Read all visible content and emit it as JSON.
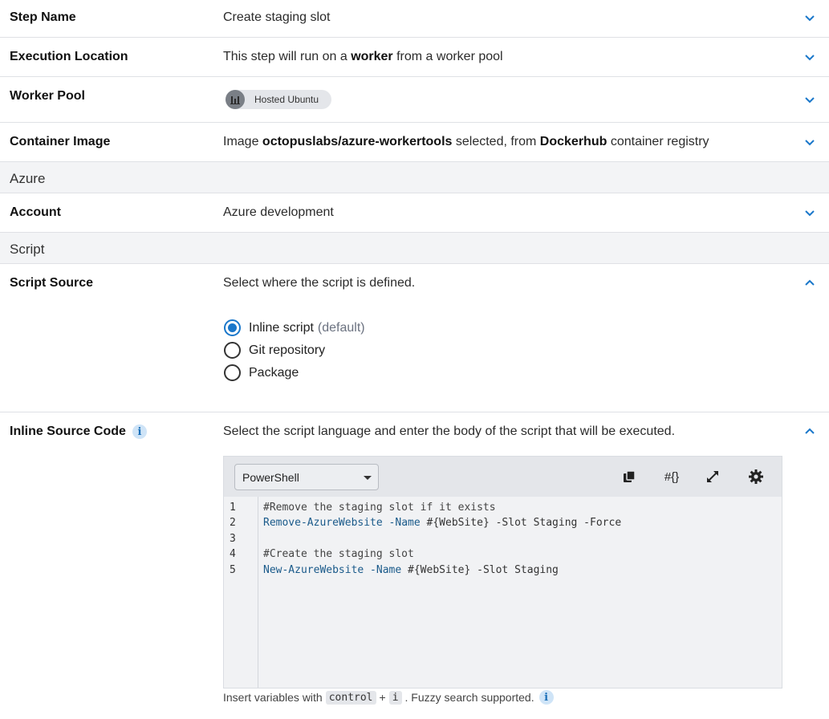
{
  "rows": {
    "step_name": {
      "label": "Step Name",
      "value": "Create staging slot"
    },
    "execution_location": {
      "label": "Execution Location",
      "value_pre": "This step will run on a ",
      "value_bold": "worker",
      "value_post": " from a worker pool"
    },
    "worker_pool": {
      "label": "Worker Pool",
      "chip_text": "Hosted Ubuntu",
      "chip_icon": "bar-chart-icon"
    },
    "container_image": {
      "label": "Container Image",
      "pre": "Image ",
      "image": "octopuslabs/azure-workertools",
      "mid": " selected, from ",
      "registry": "Dockerhub",
      "post": " container registry"
    },
    "account": {
      "label": "Account",
      "value": "Azure development"
    },
    "script_source": {
      "label": "Script Source",
      "value": "Select where the script is defined."
    },
    "inline_source": {
      "label": "Inline Source Code",
      "info": "i",
      "value": "Select the script language and enter the body of the script that will be executed."
    }
  },
  "sections": {
    "azure": "Azure",
    "script": "Script"
  },
  "script_source_options": [
    {
      "label": "Inline script",
      "suffix": "(default)",
      "selected": true
    },
    {
      "label": "Git repository",
      "selected": false
    },
    {
      "label": "Package",
      "selected": false
    }
  ],
  "editor": {
    "language": "PowerShell",
    "toolbar_icons": [
      "copy-icon",
      "variable-icon",
      "expand-icon",
      "settings-icon"
    ],
    "variable_glyph": "#{}",
    "line_numbers": [
      "1",
      "2",
      "3",
      "4",
      "5"
    ],
    "lines": [
      {
        "comment": "#Remove the staging slot if it exists"
      },
      {
        "cmd": "Remove-AzureWebsite",
        "param": " -Name",
        "rest": " #{WebSite} -Slot Staging -Force"
      },
      {
        "comment": ""
      },
      {
        "comment": "#Create the staging slot"
      },
      {
        "cmd": "New-AzureWebsite",
        "param": " -Name",
        "rest": " #{WebSite} -Slot Staging"
      }
    ]
  },
  "hint": {
    "pre": "Insert variables with",
    "key1": "control",
    "plus": "+",
    "key2": "i",
    "post": ". Fuzzy search supported.",
    "info": "i"
  },
  "colors": {
    "accent": "#1a77ca",
    "section_bg": "#f3f4f6",
    "border": "#dfe1e5"
  }
}
